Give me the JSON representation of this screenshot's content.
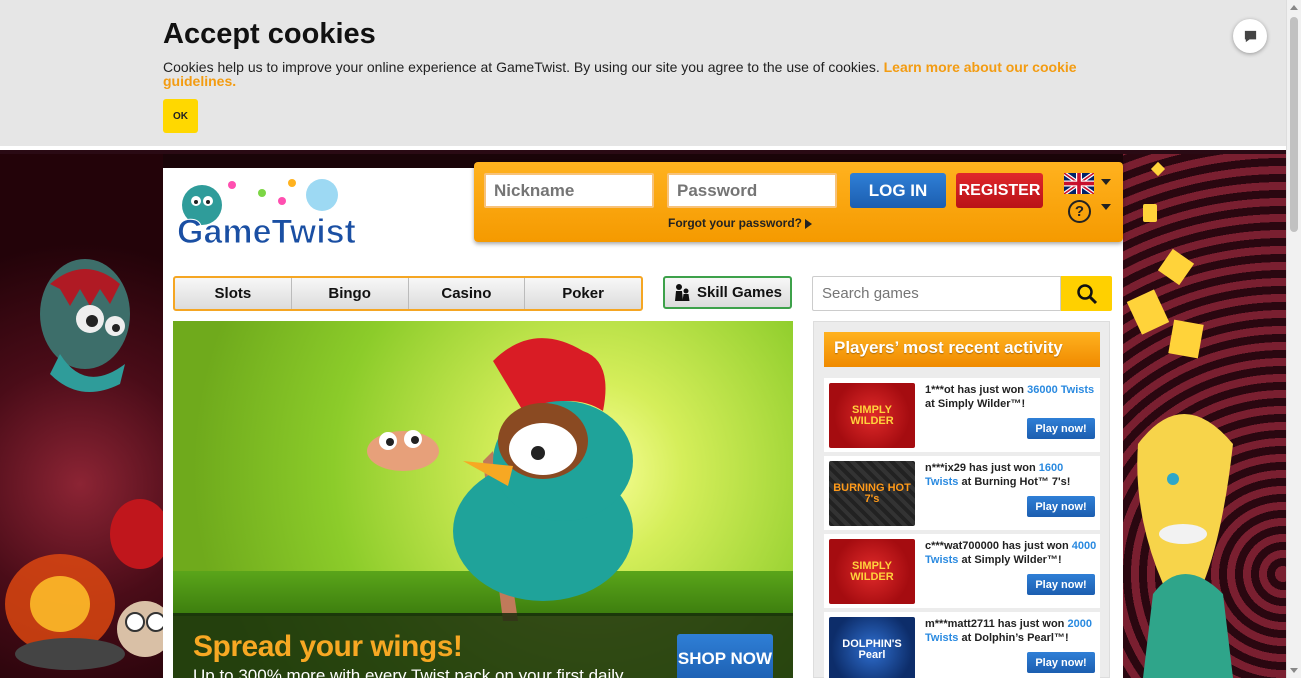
{
  "cookie": {
    "title": "Accept cookies",
    "text": "Cookies help us to improve your online experience at GameTwist. By using our site you agree to the use of cookies.",
    "link": "Learn more about our cookie guidelines.",
    "ok": "OK"
  },
  "header": {
    "logo_text": "GameTwist",
    "nickname_placeholder": "Nickname",
    "password_placeholder": "Password",
    "login": "LOG IN",
    "register": "REGISTER",
    "forgot": "Forgot your password?",
    "help": "?"
  },
  "nav": {
    "tabs": [
      "Slots",
      "Bingo",
      "Casino",
      "Poker"
    ],
    "skill": "Skill Games",
    "search_placeholder": "Search games"
  },
  "banner": {
    "title": "Spread your wings!",
    "subtitle": "Up to 300% more with every Twist pack on your first daily",
    "cta": "SHOP NOW"
  },
  "activity": {
    "title": "Players’ most recent activity",
    "play": "Play now!",
    "items": [
      {
        "user": "1***ot",
        "amount": "36000 Twists",
        "game": "Simply Wilder™!",
        "thumb": "SIMPLY WILDER",
        "thumb_style": "red"
      },
      {
        "user": "n***ix29",
        "amount": "1600 Twists",
        "game": "Burning Hot™ 7's!",
        "thumb": "BURNING HOT 7's",
        "thumb_style": "dark"
      },
      {
        "user": "c***wat700000",
        "amount": "4000 Twists",
        "game": "Simply Wilder™!",
        "thumb": "SIMPLY WILDER",
        "thumb_style": "red"
      },
      {
        "user": "m***matt2711",
        "amount": "2000 Twists",
        "game": "Dolphin’s Pearl™!",
        "thumb": "DOLPHIN'S Pearl",
        "thumb_style": "blue"
      }
    ],
    "won_text": "has just won",
    "at_text": "at"
  },
  "colors": {
    "accent_orange": "#f5a000",
    "login_blue": "#1c5eb0",
    "register_red": "#b81217",
    "highlight_blue": "#2a8ae0"
  }
}
